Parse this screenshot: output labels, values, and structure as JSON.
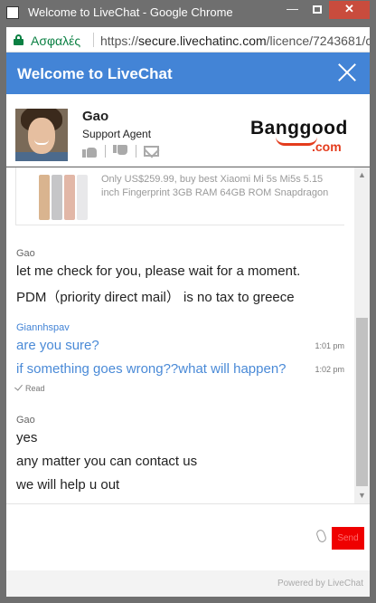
{
  "window": {
    "title": "Welcome to LiveChat - Google Chrome",
    "minimize": "—",
    "close": "✕"
  },
  "addressbar": {
    "secure_label": "Ασφαλές",
    "url_scheme": "https://",
    "url_host": "secure.livechatinc.com",
    "url_path": "/licence/7243681/c"
  },
  "header": {
    "title": "Welcome to LiveChat"
  },
  "agent": {
    "name": "Gao",
    "role": "Support Agent"
  },
  "logo": {
    "text": "Banggood",
    "suffix": ".com"
  },
  "product": {
    "description": "Only US$259.99, buy best Xiaomi Mi 5s Mi5s 5.15 inch Fingerprint 3GB RAM 64GB ROM Snapdragon"
  },
  "messages": [
    {
      "author": "Gao",
      "lines": [
        "let me check for you, please wait for a moment.",
        "PDM（priority direct mail） is no tax to greece"
      ]
    },
    {
      "author": "Giannhspav",
      "lines": [
        "are you sure?",
        "if something goes wrong??what will happen?"
      ],
      "times": [
        "1:01 pm",
        "1:02 pm"
      ],
      "status": "Read"
    },
    {
      "author": "Gao",
      "lines": [
        "yes",
        "any matter you can contact us",
        "we will help u out"
      ]
    }
  ],
  "input": {
    "placeholder": "",
    "send_label": "Send"
  },
  "footer": {
    "powered_by": "Powered by LiveChat"
  },
  "colors": {
    "header": "#4384d6",
    "visitor_text": "#4a8ad7",
    "send_button": "#ef0000",
    "secure": "#0b8043"
  },
  "icons": [
    "lock-icon",
    "close-icon",
    "thumb-up-icon",
    "thumb-down-icon",
    "mail-icon",
    "attach-icon",
    "check-icon"
  ]
}
